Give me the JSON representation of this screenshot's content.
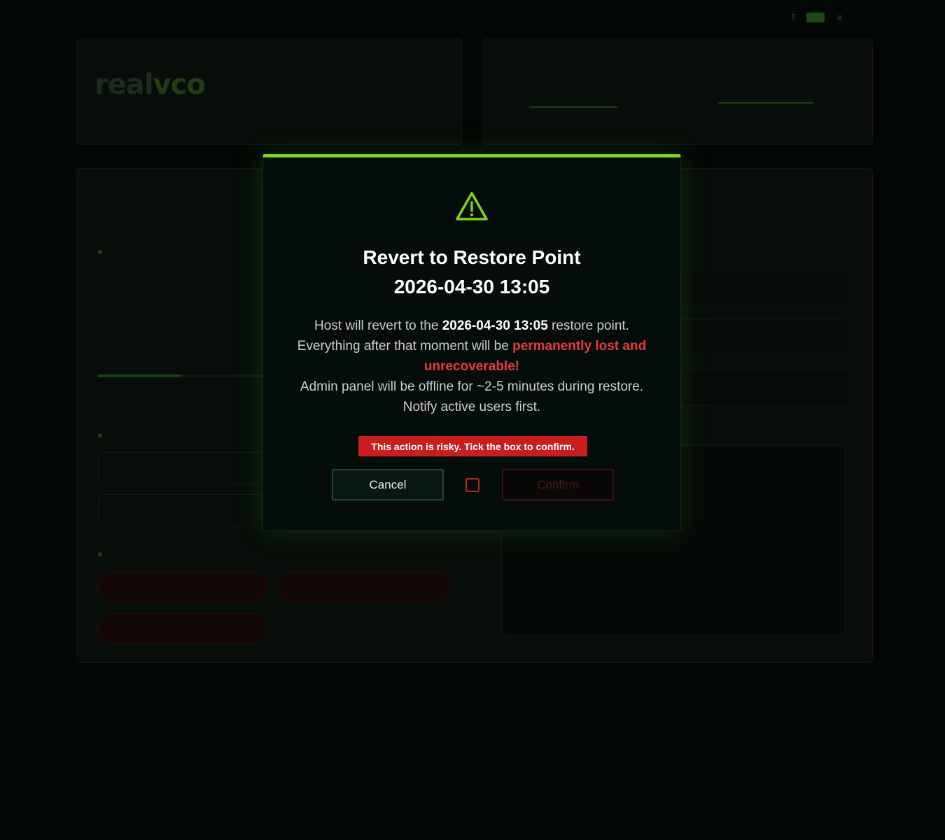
{
  "modal": {
    "title_line1": "Revert to Restore Point",
    "title_line2": "2026-04-30 13:05",
    "body": {
      "l1_pre": "Host will revert to the ",
      "l1_bold": "2026-04-30 13:05",
      "l1_post": " restore point.",
      "l2_pre": "Everything after that moment will be ",
      "l2_danger": "permanently lost and unrecoverable!",
      "l3": "Admin panel will be offline for ~2-5 minutes during restore.",
      "l4": "Notify active users first."
    },
    "risk_notice": "This action is risky. Tick the box to confirm.",
    "cancel_label": "Cancel",
    "confirm_label": "Confirm",
    "confirm_checked": false,
    "accent_color": "#7ed321",
    "danger_color": "#e83a3a"
  }
}
